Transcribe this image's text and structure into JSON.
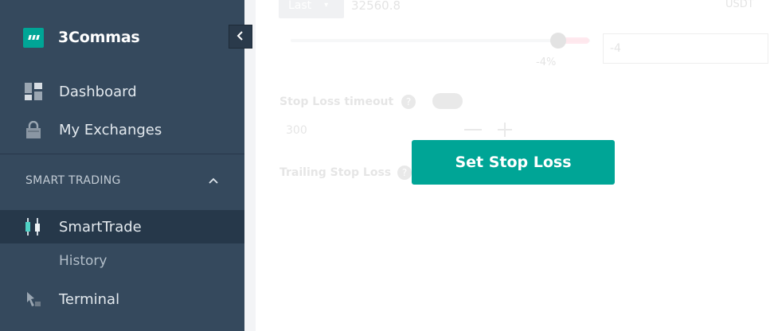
{
  "app": {
    "name": "3Commas"
  },
  "sidebar": {
    "items": [
      {
        "label": "Dashboard",
        "icon": "dashboard-icon"
      },
      {
        "label": "My Exchanges",
        "icon": "lock-icon"
      }
    ],
    "section": {
      "label": "SMART TRADING",
      "icon": "chevron-up-icon"
    },
    "smart_trading_items": [
      {
        "label": "SmartTrade",
        "icon": "smarttrade-icon",
        "active": true
      },
      {
        "label": "History",
        "icon": ""
      },
      {
        "label": "Terminal",
        "icon": "terminal-icon"
      }
    ],
    "collapse_icon": "chevron-left-icon"
  },
  "form": {
    "price_type": "Last",
    "price_value": "32560.8",
    "price_right": "USDT",
    "stop_percent_label": "-4%",
    "stop_percent_value": "-4",
    "stop_loss_percent": -4,
    "stop_loss_timeout_label": "Stop Loss timeout",
    "stop_loss_timeout_value": "300",
    "trailing_label": "Trailing Stop Loss",
    "help_glyph": "?"
  },
  "cta": {
    "label": "Set Stop Loss"
  },
  "colors": {
    "sidebar_bg": "#35495d",
    "accent": "#00a596",
    "active_bg": "#26384a"
  }
}
